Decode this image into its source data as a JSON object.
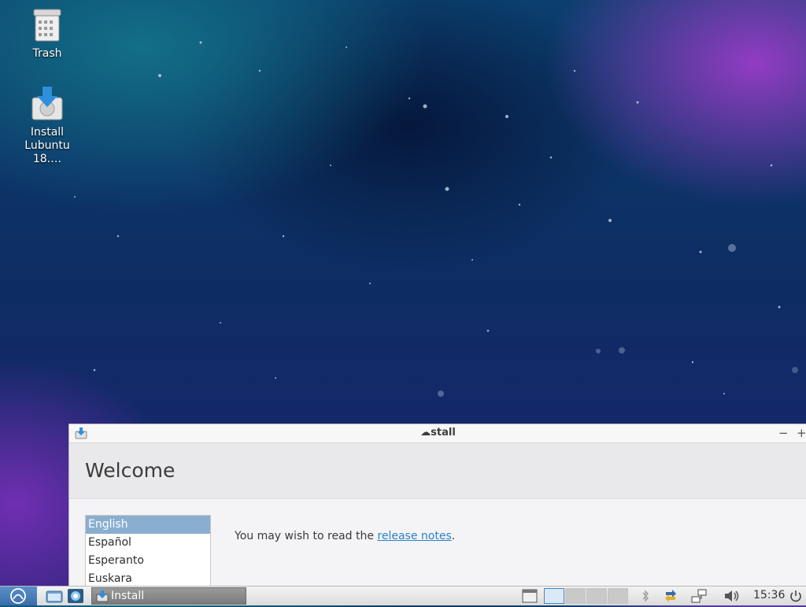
{
  "desktop": {
    "icons": [
      {
        "label": "Trash",
        "icon": "trash-icon"
      },
      {
        "label": "Install\nLubuntu 18.…",
        "label_line1": "Install",
        "label_line2": "Lubuntu 18.…",
        "icon": "installer-icon"
      }
    ]
  },
  "window": {
    "title": "Install",
    "title_shown": "☁stall",
    "minimize_label": "−",
    "maximize_label": "+",
    "heading": "Welcome",
    "languages": [
      "English",
      "Español",
      "Esperanto",
      "Euskara"
    ],
    "selected_language": "English",
    "notes_prefix": "You may wish to read the ",
    "notes_link": "release notes",
    "notes_suffix": "."
  },
  "taskbar": {
    "task_label": "Install",
    "clock": "15:36",
    "colors": {
      "accent": "#8aaed0",
      "link": "#2b82c9",
      "start": "#4a7fb8"
    }
  }
}
